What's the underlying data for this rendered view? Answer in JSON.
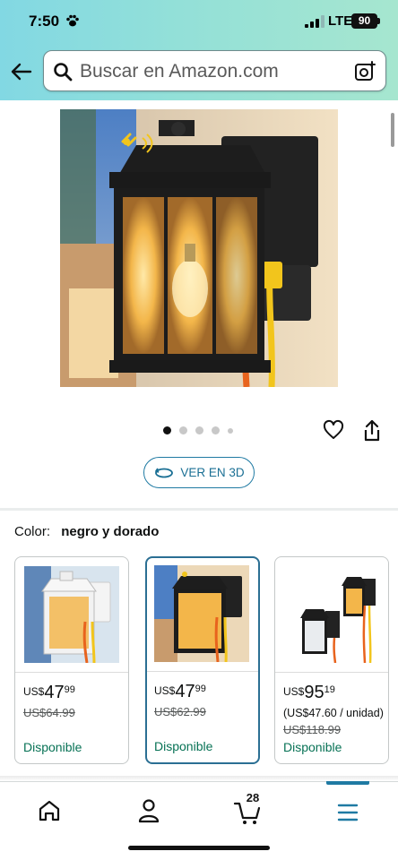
{
  "status_bar": {
    "time": "7:50",
    "network": "LTE",
    "battery": "90"
  },
  "search": {
    "placeholder": "Buscar en Amazon.com"
  },
  "product": {
    "image_count": 5,
    "active_image": 1,
    "ver3d_label": "VER EN 3D"
  },
  "color": {
    "label": "Color:",
    "value": "negro y dorado"
  },
  "variants": [
    {
      "currency": "US$",
      "whole": "47",
      "fraction": "99",
      "list_price": "US$64.99",
      "availability": "Disponible",
      "selected": false
    },
    {
      "currency": "US$",
      "whole": "47",
      "fraction": "99",
      "list_price": "US$62.99",
      "availability": "Disponible",
      "selected": true
    },
    {
      "currency": "US$",
      "whole": "95",
      "fraction": "19",
      "unit_price": "(US$47.60 / unidad)",
      "list_price": "US$118.99",
      "availability": "Disponible",
      "selected": false
    }
  ],
  "bottom_nav": {
    "cart_count": "28",
    "active": "menu"
  },
  "colors": {
    "accent": "#1f7aa3",
    "available": "#077255",
    "header": "#93e0d8"
  }
}
